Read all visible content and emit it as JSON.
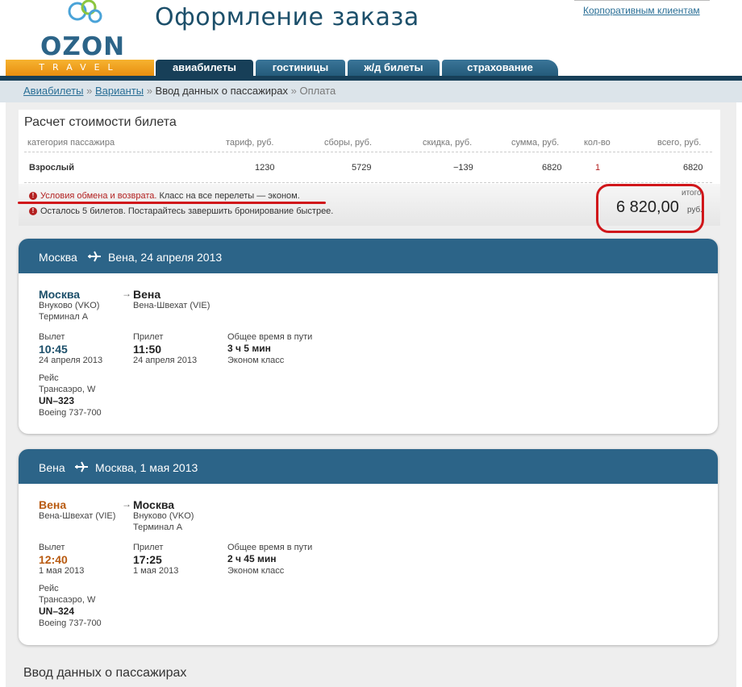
{
  "brand": {
    "name": "OZON",
    "sub": "TRAVEL"
  },
  "header": {
    "title": "Оформление заказа",
    "corporate_link": "Корпоративным клиентам"
  },
  "nav": {
    "tabs": [
      {
        "label": "авиабилеты",
        "active": true
      },
      {
        "label": "гостиницы",
        "active": false
      },
      {
        "label": "ж/д билеты",
        "active": false
      },
      {
        "label": "страхование",
        "active": false
      }
    ]
  },
  "breadcrumb": {
    "items": [
      "Авиабилеты",
      "Варианты",
      "Ввод данных о пассажирах",
      "Оплата"
    ],
    "sep": "»"
  },
  "price": {
    "title": "Расчет стоимости билета",
    "columns": [
      "категория пассажира",
      "тариф, руб.",
      "сборы, руб.",
      "скидка, руб.",
      "сумма, руб.",
      "кол-во",
      "всего, руб."
    ],
    "row": [
      "Взрослый",
      "1230",
      "5729",
      "−139",
      "6820",
      "1",
      "6820"
    ],
    "note1_link": "Условия обмена и возврата.",
    "note1_text": "Класс на все перелеты — эконом.",
    "note2_text": "Осталось 5 билетов. Постарайтесь завершить бронирование быстрее.",
    "total_label": "итого",
    "total_value": "6 820,00",
    "total_currency": "руб."
  },
  "flights": [
    {
      "header_from": "Москва",
      "header_to": "Вена, 24 апреля 2013",
      "from_city": "Москва",
      "from_airport": "Внуково (VKO)",
      "from_terminal": "Терминал А",
      "to_city": "Вена",
      "to_airport": "Вена-Швехат (VIE)",
      "depart_label": "Вылет",
      "depart_time": "10:45",
      "depart_date": "24 апреля 2013",
      "arrive_label": "Прилет",
      "arrive_time": "11:50",
      "arrive_date": "24 апреля 2013",
      "duration_label": "Общее время в пути",
      "duration": "3 ч 5 мин",
      "class": "Эконом класс",
      "flight_label": "Рейс",
      "airline": "Трансаэро, W",
      "flight_no": "UN–323",
      "aircraft": "Boeing 737-700"
    },
    {
      "header_from": "Вена",
      "header_to": "Москва, 1 мая 2013",
      "from_city": "Вена",
      "from_airport": "Вена-Швехат (VIE)",
      "to_city": "Москва",
      "to_airport": "Внуково (VKO)",
      "to_terminal": "Терминал А",
      "depart_label": "Вылет",
      "depart_time": "12:40",
      "depart_date": "1 мая 2013",
      "arrive_label": "Прилет",
      "arrive_time": "17:25",
      "arrive_date": "1 мая 2013",
      "duration_label": "Общее время в пути",
      "duration": "2 ч 45 мин",
      "class": "Эконом класс",
      "flight_label": "Рейс",
      "airline": "Трансаэро, W",
      "flight_no": "UN–324",
      "aircraft": "Boeing 737-700"
    }
  ],
  "passengers": {
    "title": "Ввод данных о пассажирах"
  },
  "colors": {
    "brand_blue": "#2c6488",
    "nav_dark": "#173f58",
    "accent_orange": "#e88e10",
    "alert_red": "#d0161a"
  },
  "icons": {
    "plane": "plane-icon",
    "info": "info-icon",
    "logo": "ozon-logo-icon"
  }
}
